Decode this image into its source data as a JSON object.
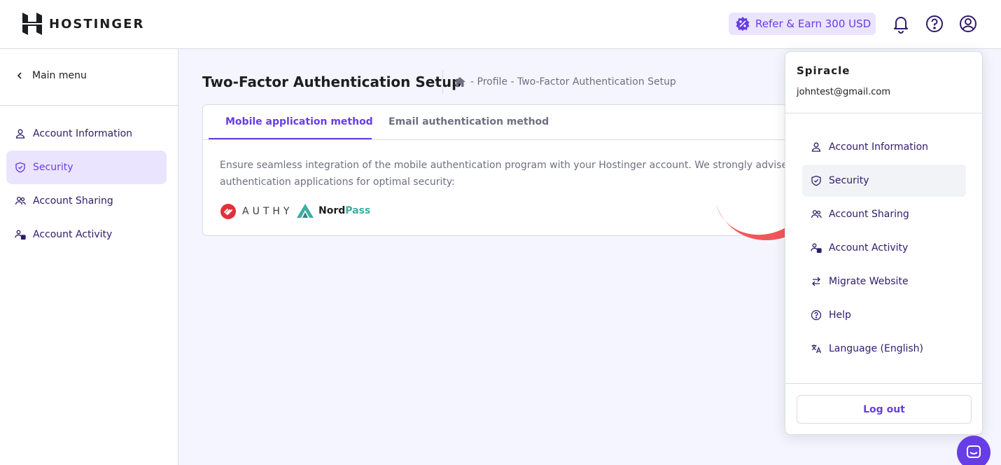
{
  "header": {
    "logo_text": "HOSTINGER",
    "refer_label": "Refer & Earn 300 USD",
    "accent_color": "#673de6"
  },
  "sidebar": {
    "main_menu_label": "Main menu",
    "items": [
      {
        "label": "Account Information",
        "icon": "user-icon"
      },
      {
        "label": "Security",
        "icon": "shield-icon",
        "active": true
      },
      {
        "label": "Account Sharing",
        "icon": "users-icon"
      },
      {
        "label": "Account Activity",
        "icon": "activity-icon"
      }
    ]
  },
  "page": {
    "title": "Two-Factor Authentication Setup",
    "breadcrumb": "- Profile - Two-Factor Authentication Setup"
  },
  "card": {
    "tabs": [
      {
        "label": "Mobile application method",
        "active": true
      },
      {
        "label": "Email authentication method",
        "active": false
      }
    ],
    "description_line1": "Ensure seamless integration of the mobile authentication program with your Hostinger account. We strongly advise employing",
    "description_line2": "authentication applications for optimal security:",
    "apps": {
      "authy": "AUTHY",
      "nordpass_nord": "Nord",
      "nordpass_pass": "Pass"
    }
  },
  "dropdown": {
    "name": "Spiracle",
    "email": "johntest@gmail.com",
    "items": [
      {
        "label": "Account Information",
        "icon": "user-icon"
      },
      {
        "label": "Security",
        "icon": "shield-icon"
      },
      {
        "label": "Account Sharing",
        "icon": "users-icon"
      },
      {
        "label": "Account Activity",
        "icon": "activity-icon"
      },
      {
        "label": "Migrate Website",
        "icon": "transfer-icon"
      },
      {
        "label": "Help",
        "icon": "help-icon"
      },
      {
        "label": "Language (English)",
        "icon": "translate-icon"
      }
    ],
    "logout_label": "Log out"
  }
}
